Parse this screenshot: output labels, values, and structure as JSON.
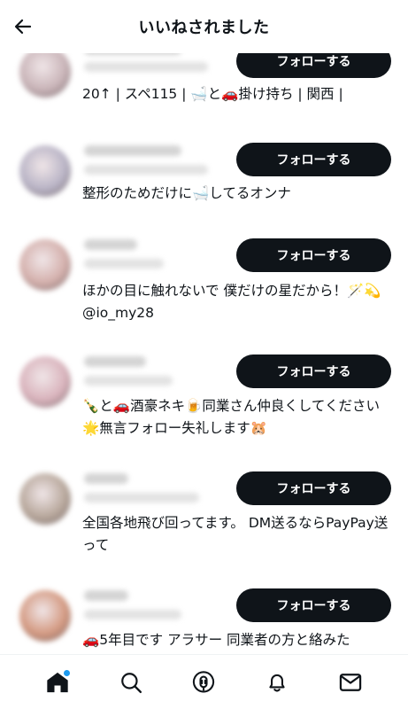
{
  "header": {
    "title": "いいねされました"
  },
  "follow_label": "フォローする",
  "users": [
    {
      "bio": "20↑ | スペ115 | 🛁と🚗掛け持ち | 関西 |",
      "avatar_color": "#c9b4b8"
    },
    {
      "bio": "整形のためだけに🛁してるオンナ",
      "avatar_color": "#b9b4c6"
    },
    {
      "bio": "ほかの目に触れないで 僕だけの星だから！🪄💫@io_my28",
      "avatar_color": "#d4b0ac"
    },
    {
      "bio": "🍾と🚗酒豪ネキ🍺同業さん仲良くしてください🌟無言フォロー失礼します🐹",
      "avatar_color": "#d9b3bc"
    },
    {
      "bio": "全国各地飛び回ってます。 DM送るならPayPay送って",
      "avatar_color": "#b8a89c"
    },
    {
      "bio": "🚗5年目です アラサー 同業者の方と絡みた",
      "avatar_color": "#d49a82"
    }
  ],
  "tabs": [
    {
      "name": "home-icon",
      "has_dot": true
    },
    {
      "name": "search-icon"
    },
    {
      "name": "spaces-icon"
    },
    {
      "name": "notifications-icon"
    },
    {
      "name": "messages-icon"
    }
  ]
}
